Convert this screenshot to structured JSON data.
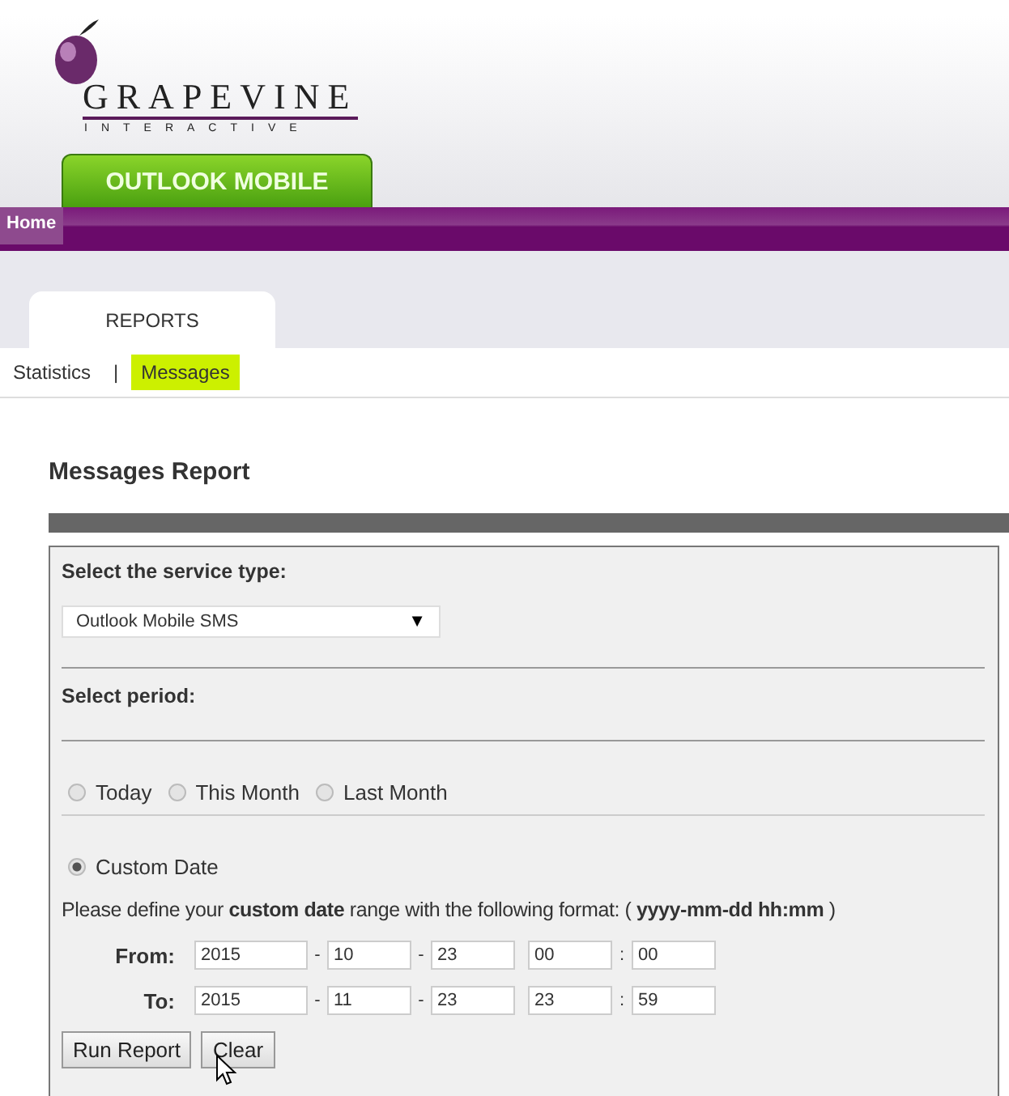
{
  "brand": {
    "name": "GRAPEVINE",
    "tagline": "INTERACTIVE",
    "product": "OUTLOOK MOBILE"
  },
  "nav": [
    {
      "label": "Home",
      "selected": true
    }
  ],
  "tabs": [
    {
      "label": "REPORTS",
      "selected": true
    }
  ],
  "subnav": [
    {
      "label": "Statistics",
      "selected": false
    },
    {
      "label": "Messages",
      "selected": true
    }
  ],
  "subnav_separator": "|",
  "page_title": "Messages Report",
  "form": {
    "service_label": "Select the service type:",
    "service_value": "Outlook Mobile SMS",
    "service_caret": "▼",
    "period_label": "Select period:",
    "period_rows": [
      {
        "options": [
          {
            "label": "Today",
            "selected": false
          },
          {
            "label": "This Month",
            "selected": false
          },
          {
            "label": "Last Month",
            "selected": false
          }
        ]
      },
      {
        "options": [
          {
            "label": "Custom Date",
            "selected": true
          }
        ]
      }
    ],
    "hint": "Please define your **custom date** range with the following format: ( **yyyy-mm-dd hh:mm** )",
    "date_rows": [
      {
        "label": "From:",
        "parts": [
          {
            "kind": "field",
            "value": "2015"
          },
          {
            "kind": "sep",
            "text": "-"
          },
          {
            "kind": "field",
            "value": "10"
          },
          {
            "kind": "sep",
            "text": "-"
          },
          {
            "kind": "field",
            "value": "23"
          },
          {
            "kind": "gap"
          },
          {
            "kind": "field",
            "value": "00"
          },
          {
            "kind": "sep",
            "text": ":"
          },
          {
            "kind": "field",
            "value": "00"
          }
        ]
      },
      {
        "label": "To:",
        "parts": [
          {
            "kind": "field",
            "value": "2015"
          },
          {
            "kind": "sep",
            "text": "-"
          },
          {
            "kind": "field",
            "value": "11"
          },
          {
            "kind": "sep",
            "text": "-"
          },
          {
            "kind": "field",
            "value": "23"
          },
          {
            "kind": "gap"
          },
          {
            "kind": "field",
            "value": "23"
          },
          {
            "kind": "sep",
            "text": ":"
          },
          {
            "kind": "field",
            "value": "59"
          }
        ]
      }
    ],
    "buttons": [
      "Run Report",
      "Clear"
    ]
  }
}
